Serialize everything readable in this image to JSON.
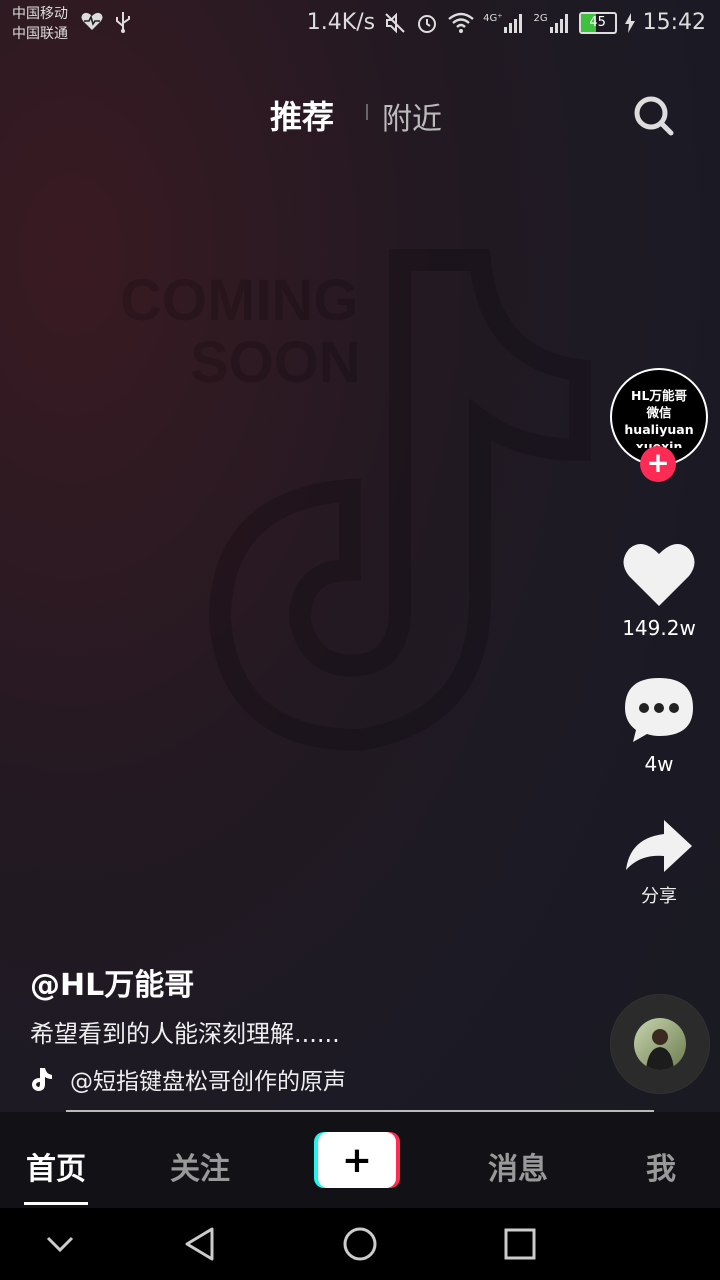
{
  "status_bar": {
    "carrier_1": "中国移动",
    "carrier_2": "中国联通",
    "net_speed": "1.4K/s",
    "signal_1_label": "4G⁺",
    "signal_2_label": "2G",
    "battery_level": "45",
    "time": "15:42"
  },
  "top_tabs": {
    "recommended": "推荐",
    "nearby": "附近"
  },
  "background_watermark": {
    "line1": "COMING",
    "line2": "SOON"
  },
  "creator": {
    "avatar_lines": [
      "HL万能哥",
      "微信",
      "hualiyuan",
      "xuexin"
    ]
  },
  "actions": {
    "likes": "149.2w",
    "comments": "4w",
    "share": "分享"
  },
  "video": {
    "username": "@HL万能哥",
    "description": "希望看到的人能深刻理解......",
    "music": "@短指键盘松哥创作的原声"
  },
  "bottom_nav": {
    "home": "首页",
    "follow": "关注",
    "create": "+",
    "messages": "消息",
    "me": "我"
  },
  "colors": {
    "accent_red": "#fe2c55",
    "accent_cyan": "#25f4ee",
    "battery_green": "#3ec23e"
  }
}
